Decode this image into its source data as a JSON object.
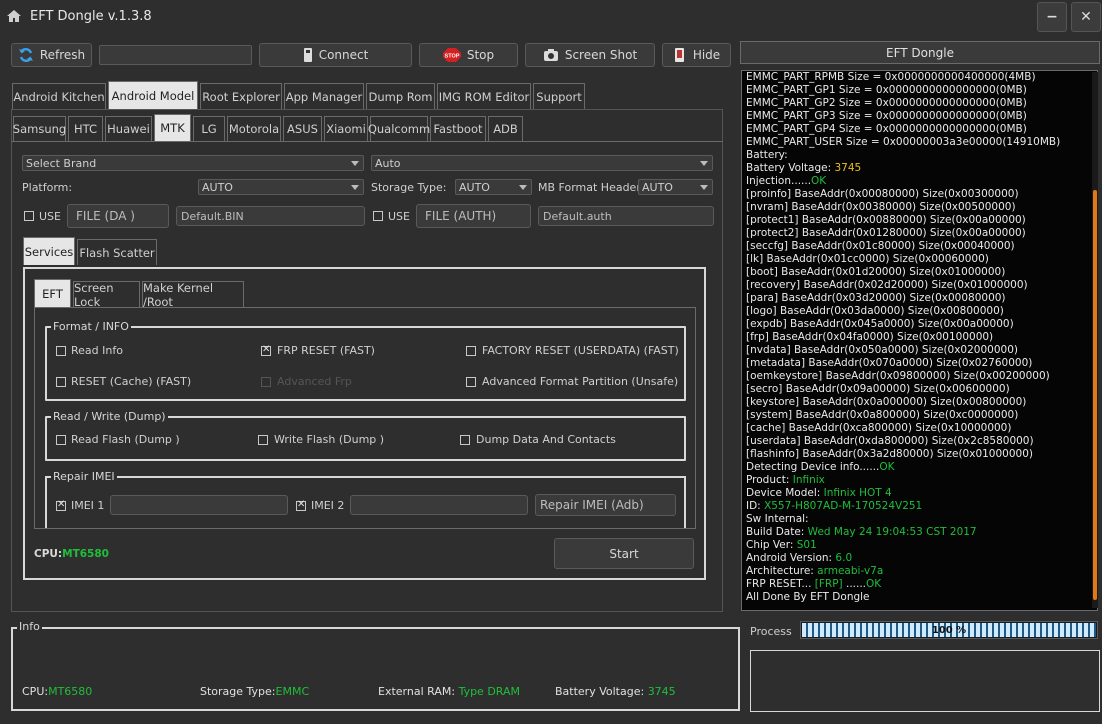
{
  "window": {
    "title": "EFT Dongle  v.1.3.8",
    "minimize": "−",
    "close": "✕"
  },
  "toolbar": {
    "refresh": "Refresh",
    "connect": "Connect",
    "stop": "Stop",
    "stop_badge": "STOP",
    "screenshot": "Screen Shot",
    "hide": "Hide",
    "port_select": ""
  },
  "main_tabs": [
    "Android Kitchen",
    "Android Model",
    "Root Explorer",
    "App Manager",
    "Dump Rom",
    "IMG ROM Editor",
    "Support"
  ],
  "brand_tabs": [
    "Samsung",
    "HTC",
    "Huawei",
    "MTK",
    "LG",
    "Motorola",
    "ASUS",
    "Xiaomi",
    "Qualcomm",
    "Fastboot",
    "ADB"
  ],
  "config": {
    "brand": "Select Brand",
    "mode": "Auto",
    "platform_label": "Platform:",
    "platform": "AUTO",
    "storage_label": "Storage Type:",
    "storage": "AUTO",
    "mbformat_label": "MB Format Header",
    "mbformat": "AUTO",
    "use_label": "USE",
    "file_da": "FILE (DA )",
    "da_value": "Default.BIN",
    "file_auth": "FILE (AUTH)",
    "auth_value": "Default.auth"
  },
  "sub_tabs": [
    "Services",
    "Flash Scatter"
  ],
  "eft_tabs": [
    "EFT",
    "Screen Lock",
    "Make Kernel  /Root"
  ],
  "format_group": {
    "title": "Format / INFO",
    "read_info": "Read Info",
    "frp_reset": "FRP RESET (FAST)",
    "factory_reset": "FACTORY RESET (USERDATA) (FAST)",
    "reset_cache": "RESET (Cache) (FAST)",
    "advanced_frp": "Advanced Frp",
    "advanced_format": "Advanced Format Partition (Unsafe)"
  },
  "rw_group": {
    "title": "Read / Write (Dump)",
    "read_flash": "Read Flash (Dump )",
    "write_flash": "Write Flash (Dump )",
    "dump_data": "Dump Data And Contacts"
  },
  "imei_group": {
    "title": "Repair IMEI",
    "imei1": "IMEI 1",
    "imei2": "IMEI 2",
    "repair": "Repair IMEI (Adb)"
  },
  "cpu": {
    "label": "CPU:",
    "value": "MT6580"
  },
  "start": "Start",
  "log_panel": {
    "title": "EFT Dongle"
  },
  "log": [
    [
      {
        "t": "EMMC_PART_RPMB Size = 0x0000000000400000(4MB)"
      }
    ],
    [
      {
        "t": "EMMC_PART_GP1 Size = 0x0000000000000000(0MB)"
      }
    ],
    [
      {
        "t": "EMMC_PART_GP2 Size = 0x0000000000000000(0MB)"
      }
    ],
    [
      {
        "t": "EMMC_PART_GP3 Size = 0x0000000000000000(0MB)"
      }
    ],
    [
      {
        "t": "EMMC_PART_GP4 Size = 0x0000000000000000(0MB)"
      }
    ],
    [
      {
        "t": "EMMC_PART_USER Size = 0x00000003a3e00000(14910MB)"
      }
    ],
    [
      {
        "t": "Battery:"
      }
    ],
    [
      {
        "t": "Battery Voltage: "
      },
      {
        "t": "3745",
        "c": "y"
      }
    ],
    [
      {
        "t": "Injection......"
      },
      {
        "t": "OK",
        "c": "g"
      }
    ],
    [
      {
        "t": "[proinfo] BaseAddr(0x00080000) Size(0x00300000)"
      }
    ],
    [
      {
        "t": "[nvram] BaseAddr(0x00380000) Size(0x00500000)"
      }
    ],
    [
      {
        "t": "[protect1] BaseAddr(0x00880000) Size(0x00a00000)"
      }
    ],
    [
      {
        "t": "[protect2] BaseAddr(0x01280000) Size(0x00a00000)"
      }
    ],
    [
      {
        "t": "[seccfg] BaseAddr(0x01c80000) Size(0x00040000)"
      }
    ],
    [
      {
        "t": "[lk] BaseAddr(0x01cc0000) Size(0x00060000)"
      }
    ],
    [
      {
        "t": "[boot] BaseAddr(0x01d20000) Size(0x01000000)"
      }
    ],
    [
      {
        "t": "[recovery] BaseAddr(0x02d20000) Size(0x01000000)"
      }
    ],
    [
      {
        "t": "[para] BaseAddr(0x03d20000) Size(0x00080000)"
      }
    ],
    [
      {
        "t": "[logo] BaseAddr(0x03da0000) Size(0x00800000)"
      }
    ],
    [
      {
        "t": "[expdb] BaseAddr(0x045a0000) Size(0x00a00000)"
      }
    ],
    [
      {
        "t": "[frp] BaseAddr(0x04fa0000) Size(0x00100000)"
      }
    ],
    [
      {
        "t": "[nvdata] BaseAddr(0x050a0000) Size(0x02000000)"
      }
    ],
    [
      {
        "t": "[metadata] BaseAddr(0x070a0000) Size(0x02760000)"
      }
    ],
    [
      {
        "t": "[oemkeystore] BaseAddr(0x09800000) Size(0x00200000)"
      }
    ],
    [
      {
        "t": "[secro] BaseAddr(0x09a00000) Size(0x00600000)"
      }
    ],
    [
      {
        "t": "[keystore] BaseAddr(0x0a000000) Size(0x00800000)"
      }
    ],
    [
      {
        "t": "[system] BaseAddr(0x0a800000) Size(0xc0000000)"
      }
    ],
    [
      {
        "t": "[cache] BaseAddr(0xca800000) Size(0x10000000)"
      }
    ],
    [
      {
        "t": "[userdata] BaseAddr(0xda800000) Size(0x2c8580000)"
      }
    ],
    [
      {
        "t": "[flashinfo] BaseAddr(0x3a2d80000) Size(0x01000000)"
      }
    ],
    [
      {
        "t": "Detecting Device info......"
      },
      {
        "t": "OK",
        "c": "g"
      }
    ],
    [
      {
        "t": "Product: "
      },
      {
        "t": "Infinix",
        "c": "g"
      }
    ],
    [
      {
        "t": "Device Model: "
      },
      {
        "t": "Infinix HOT 4",
        "c": "g"
      }
    ],
    [
      {
        "t": "ID: "
      },
      {
        "t": "X557-H807AD-M-170524V251",
        "c": "g"
      }
    ],
    [
      {
        "t": "Sw Internal:"
      }
    ],
    [
      {
        "t": "Build Date: "
      },
      {
        "t": "Wed May 24 19:04:53 CST 2017",
        "c": "g"
      }
    ],
    [
      {
        "t": "Chip Ver: "
      },
      {
        "t": "S01",
        "c": "g"
      }
    ],
    [
      {
        "t": "Android Version: "
      },
      {
        "t": "6.0",
        "c": "g"
      }
    ],
    [
      {
        "t": "Architecture: "
      },
      {
        "t": "armeabi-v7a",
        "c": "g"
      }
    ],
    [
      {
        "t": "FRP RESET... "
      },
      {
        "t": "[FRP]",
        "c": "g"
      },
      {
        "t": " ......"
      },
      {
        "t": "OK",
        "c": "g"
      }
    ],
    [
      {
        "t": "All Done By EFT Dongle"
      }
    ]
  ],
  "process": {
    "label": "Process",
    "percent": "100 %",
    "progress": 1.0
  },
  "info": {
    "title": "Info",
    "cpu_label": "CPU:",
    "cpu": "MT6580",
    "storage_label": "Storage Type:",
    "storage": "EMMC",
    "ram_label": "External RAM:",
    "ram": "Type DRAM",
    "battery_label": "Battery Voltage:",
    "battery": "3745"
  },
  "colors": {
    "bg": "#2e2e2e",
    "accent_green": "#1fbf3a",
    "accent_yellow": "#e8c21a",
    "log_bg": "#050505"
  }
}
